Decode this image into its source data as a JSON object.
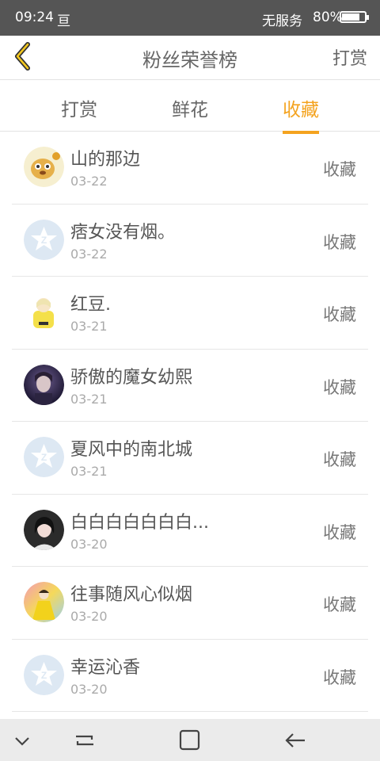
{
  "status": {
    "time": "09:24",
    "notification": "亘",
    "carrier": "无服务",
    "battery_text": "80%",
    "battery_level": 0.8
  },
  "nav": {
    "title": "粉丝荣誉榜",
    "right": "打赏"
  },
  "tabs": [
    {
      "label": "打赏"
    },
    {
      "label": "鲜花"
    },
    {
      "label": "收藏",
      "active": true
    }
  ],
  "items": [
    {
      "name": "山的那边",
      "date": "03-22",
      "action": "收藏",
      "avatar": "cartoon-dog"
    },
    {
      "name": "痞女没有烟。",
      "date": "03-22",
      "action": "收藏",
      "avatar": "default-star"
    },
    {
      "name": "红豆.",
      "date": "03-21",
      "action": "收藏",
      "avatar": "cartoon-girl"
    },
    {
      "name": "骄傲的魔女幼熙",
      "date": "03-21",
      "action": "收藏",
      "avatar": "photo-purple"
    },
    {
      "name": "夏风中的南北城",
      "date": "03-21",
      "action": "收藏",
      "avatar": "default-star"
    },
    {
      "name": "白白白白白白白...",
      "date": "03-20",
      "action": "收藏",
      "avatar": "photo-girl"
    },
    {
      "name": "往事随风心似烟",
      "date": "03-20",
      "action": "收藏",
      "avatar": "yellow-dress"
    },
    {
      "name": "幸运沁香",
      "date": "03-20",
      "action": "收藏",
      "avatar": "default-star"
    }
  ],
  "colors": {
    "accent": "#f4a31f",
    "statusbar": "#555555",
    "avatar_default": "#dde8f3"
  }
}
